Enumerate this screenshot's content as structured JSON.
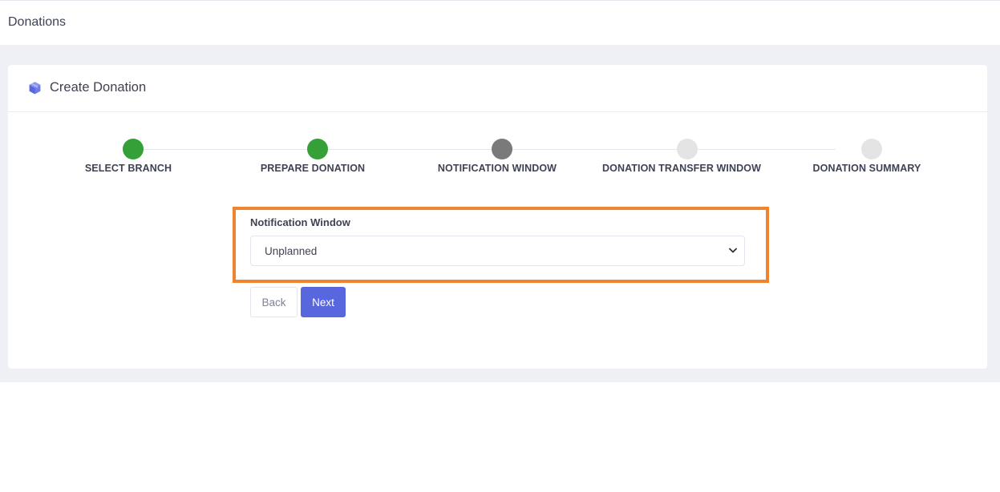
{
  "header": {
    "title": "Donations"
  },
  "card": {
    "title": "Create Donation",
    "icon": "box-icon"
  },
  "stepper": {
    "steps": [
      {
        "label": "SELECT BRANCH",
        "state": "completed",
        "color": "#35a038"
      },
      {
        "label": "PREPARE DONATION",
        "state": "completed",
        "color": "#35a038"
      },
      {
        "label": "NOTIFICATION WINDOW",
        "state": "current",
        "color": "#7a7a7a"
      },
      {
        "label": "DONATION TRANSFER WINDOW",
        "state": "pending",
        "color": "#e4e4e4"
      },
      {
        "label": "DONATION SUMMARY",
        "state": "pending",
        "color": "#e4e4e4"
      }
    ]
  },
  "form": {
    "label": "Notification Window",
    "selected_value": "Unplanned"
  },
  "buttons": {
    "back_label": "Back",
    "next_label": "Next"
  },
  "colors": {
    "accent": "#5867dd",
    "highlight": "#f0842e",
    "completed": "#35a038",
    "current": "#7a7a7a",
    "pending": "#e4e4e4"
  }
}
